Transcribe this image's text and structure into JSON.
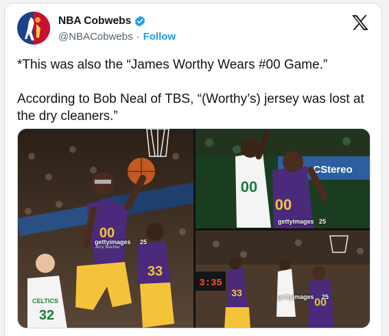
{
  "account": {
    "display_name": "NBA Cobwebs",
    "handle": "@NBACobwebs",
    "separator": "·",
    "follow_label": "Follow",
    "verified": true
  },
  "tweet": {
    "text": "*This was also the “James Worthy Wears #00 Game.”\n\nAccording to Bob Neal of TBS, “(Worthy’s) jersey was lost at the dry cleaners.”"
  },
  "media": {
    "photo1": {
      "watermark": "gettyimages",
      "credit": "Jerry Wachter",
      "jersey_primary": "00",
      "jersey_secondary": "33",
      "jersey_opponent": "32",
      "opponent_text": "CELTICS",
      "badge": "25"
    },
    "photo2": {
      "watermark": "gettyimages",
      "jersey_primary": "00",
      "jersey_opponent": "00",
      "signage": "CStereo",
      "badge": "25"
    },
    "photo3": {
      "watermark": "gettyimages",
      "jersey_primary": "00",
      "jersey_secondary": "33",
      "scoreboard": "3:35",
      "badge": "25"
    }
  },
  "colors": {
    "lakers_purple": "#4b2a7b",
    "lakers_gold": "#f5c33a",
    "celtics_green": "#1f7a3a",
    "link_blue": "#1d9bf0",
    "muted": "#536471"
  },
  "icons": [
    "avatar-logo-icon",
    "verified-badge-icon",
    "x-logo-icon"
  ]
}
